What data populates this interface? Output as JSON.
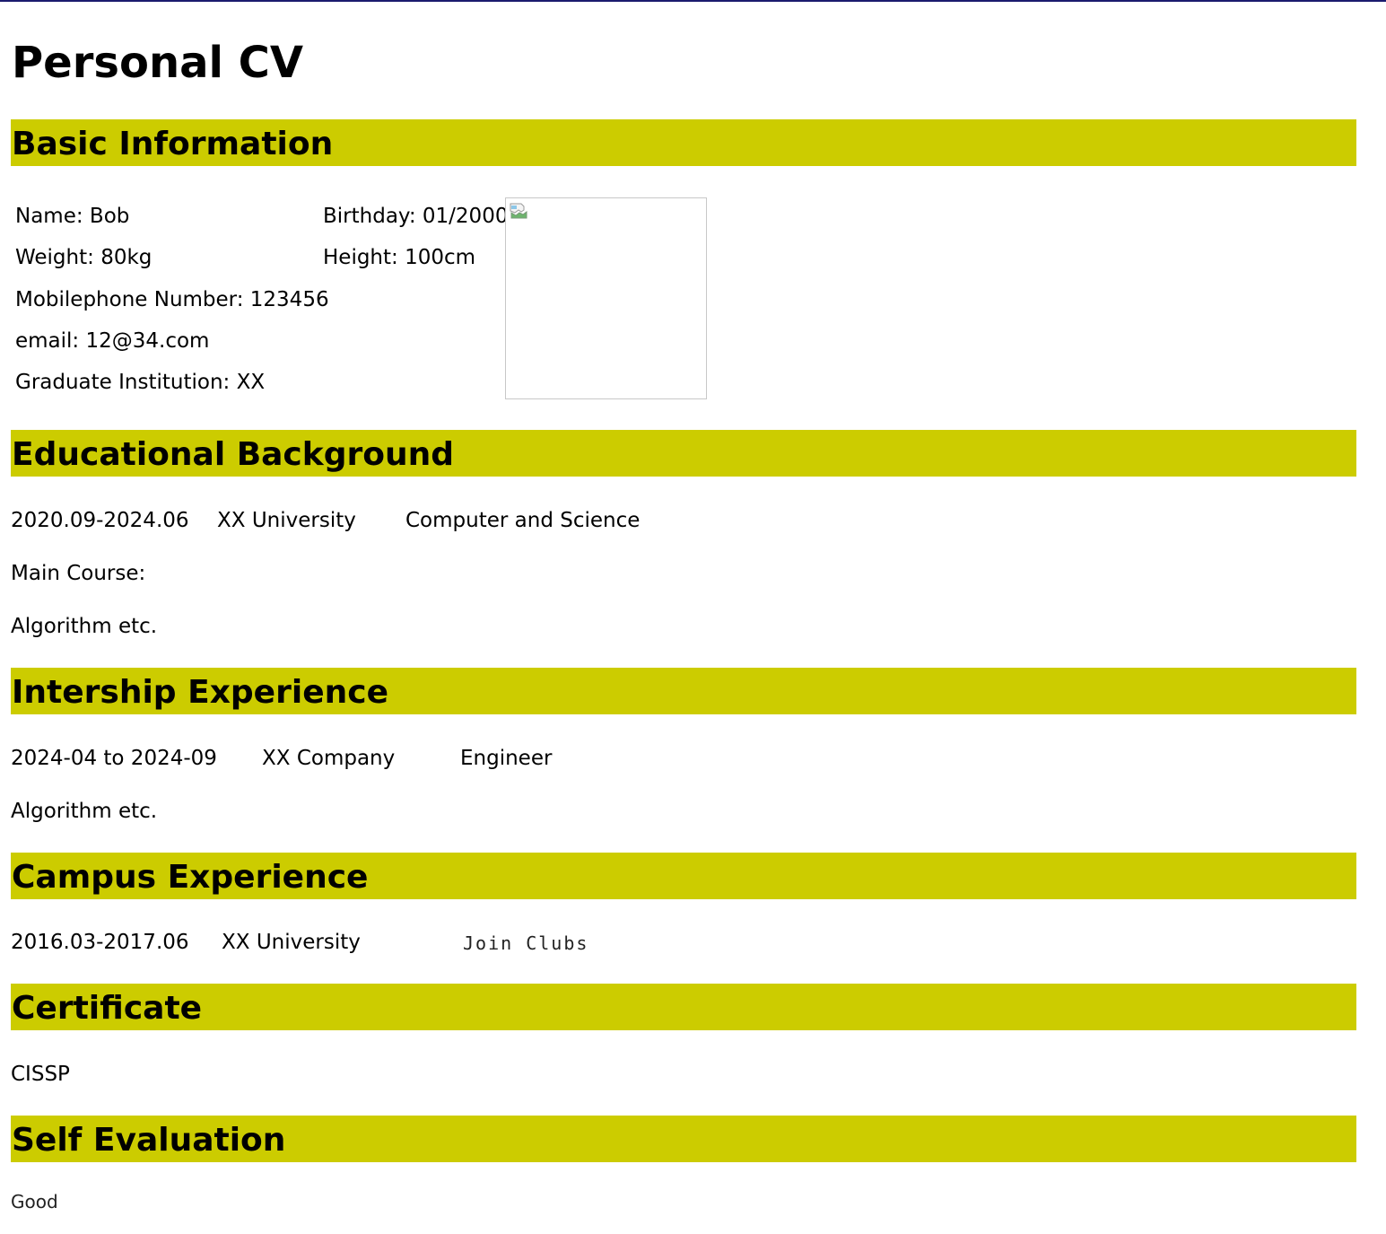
{
  "title": "Personal CV",
  "sections": {
    "basic": "Basic Information",
    "education": "Educational Background",
    "internship": "Intership Experience",
    "campus": "Campus Experience",
    "certificate": "Certificate",
    "self_eval": "Self Evaluation"
  },
  "basic_info": {
    "name": "Name: Bob",
    "birthday": "Birthday: 01/2000",
    "weight": "Weight: 80kg",
    "height": "Height: 100cm",
    "mobile": "Mobilephone Number: 123456",
    "email": "email: 12@34.com",
    "institution": "Graduate Institution: XX",
    "photo_icon": "broken-image-icon"
  },
  "education": {
    "period": "2020.09-2024.06",
    "school": "XX University",
    "major": "Computer and Science",
    "course_label": "Main Course:",
    "course_text": "Algorithm etc."
  },
  "internship": {
    "period": "2024-04 to 2024-09",
    "company": "XX Company",
    "role": "Engineer",
    "description": "Algorithm etc."
  },
  "campus": {
    "period": "2016.03-2017.06",
    "school": "XX University",
    "activity": "Join Clubs"
  },
  "certificate": {
    "item": "CISSP"
  },
  "self_evaluation": {
    "text": "Good"
  },
  "colors": {
    "section_bar": "#cccc00",
    "top_line": "#1a1a6e"
  }
}
